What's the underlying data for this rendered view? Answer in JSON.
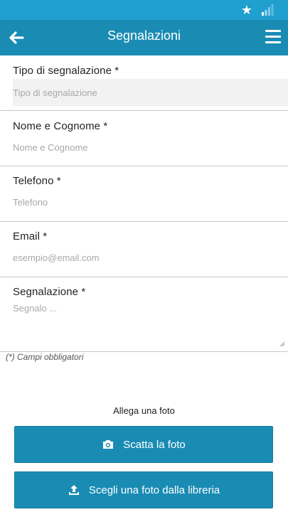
{
  "status_bar": {
    "icons": [
      "star-icon",
      "signal-icon"
    ]
  },
  "header": {
    "title": "Segnalazioni",
    "back_icon": "arrow-left-icon",
    "menu_icon": "hamburger-menu-icon"
  },
  "form": {
    "tipo": {
      "label": "Tipo di segnalazione *",
      "placeholder": "Tipo di segnalazione"
    },
    "nome": {
      "label": "Nome e Cognome *",
      "placeholder": "Nome e Cognome"
    },
    "telefono": {
      "label": "Telefono *",
      "placeholder": "Telefono"
    },
    "email": {
      "label": "Email *",
      "placeholder": "esempio@email.com"
    },
    "segnalazione": {
      "label": "Segnalazione *",
      "placeholder": "Segnalo ..."
    },
    "required_note": "(*) Campi obbligatori"
  },
  "attach": {
    "label": "Allega una foto",
    "take_photo": "Scatta la foto",
    "choose_library": "Scegli una foto dalla libreria"
  },
  "colors": {
    "status_bar": "#1fa0cf",
    "app_bar": "#1a8cb4",
    "button": "#1a8cb4"
  }
}
